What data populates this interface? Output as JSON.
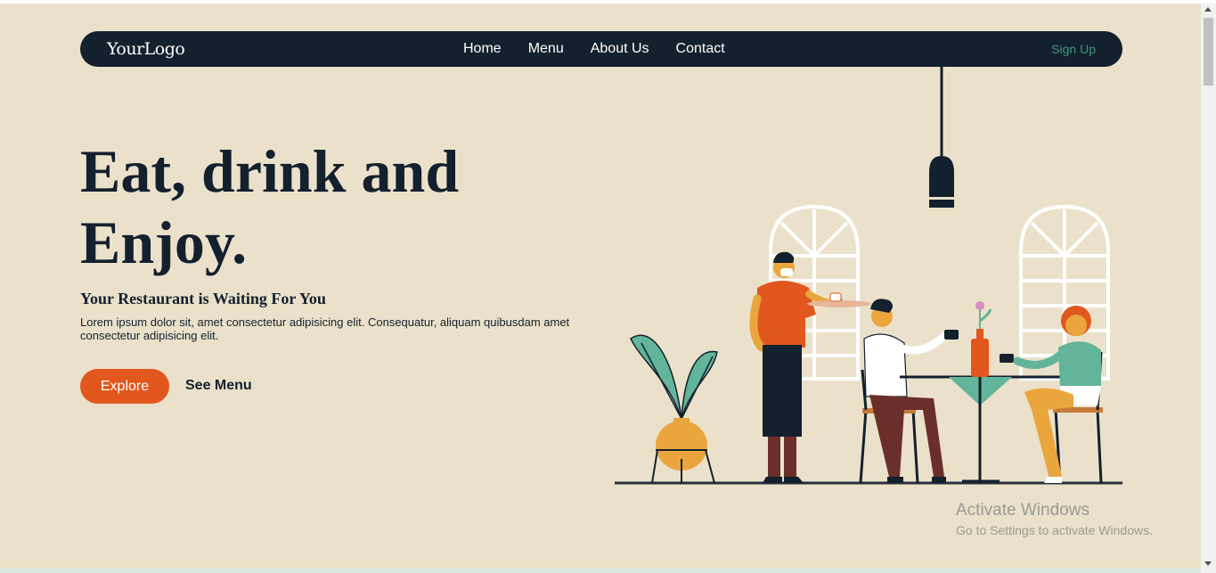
{
  "navbar": {
    "logo": "YourLogo",
    "links": [
      "Home",
      "Menu",
      "About Us",
      "Contact"
    ],
    "signup": "Sign Up"
  },
  "hero": {
    "title_line1": "Eat, drink and",
    "title_line2": "Enjoy.",
    "subtitle": "Your Restaurant is Waiting For You",
    "description": "Lorem ipsum dolor sit, amet consectetur adipisicing elit. Consequatur, aliquam quibusdam amet consectetur adipisicing elit.",
    "explore_label": "Explore",
    "menu_label": "See Menu"
  },
  "watermark": {
    "title": "Activate Windows",
    "subtitle": "Go to Settings to activate Windows."
  },
  "colors": {
    "background": "#ebe1ca",
    "navbar": "#13202e",
    "accent": "#e2571e",
    "signup": "#3d9a7c"
  },
  "icons": {
    "illustration": "restaurant-scene-illustration",
    "scroll_up": "chevron-up-icon",
    "scroll_down": "chevron-down-icon"
  }
}
